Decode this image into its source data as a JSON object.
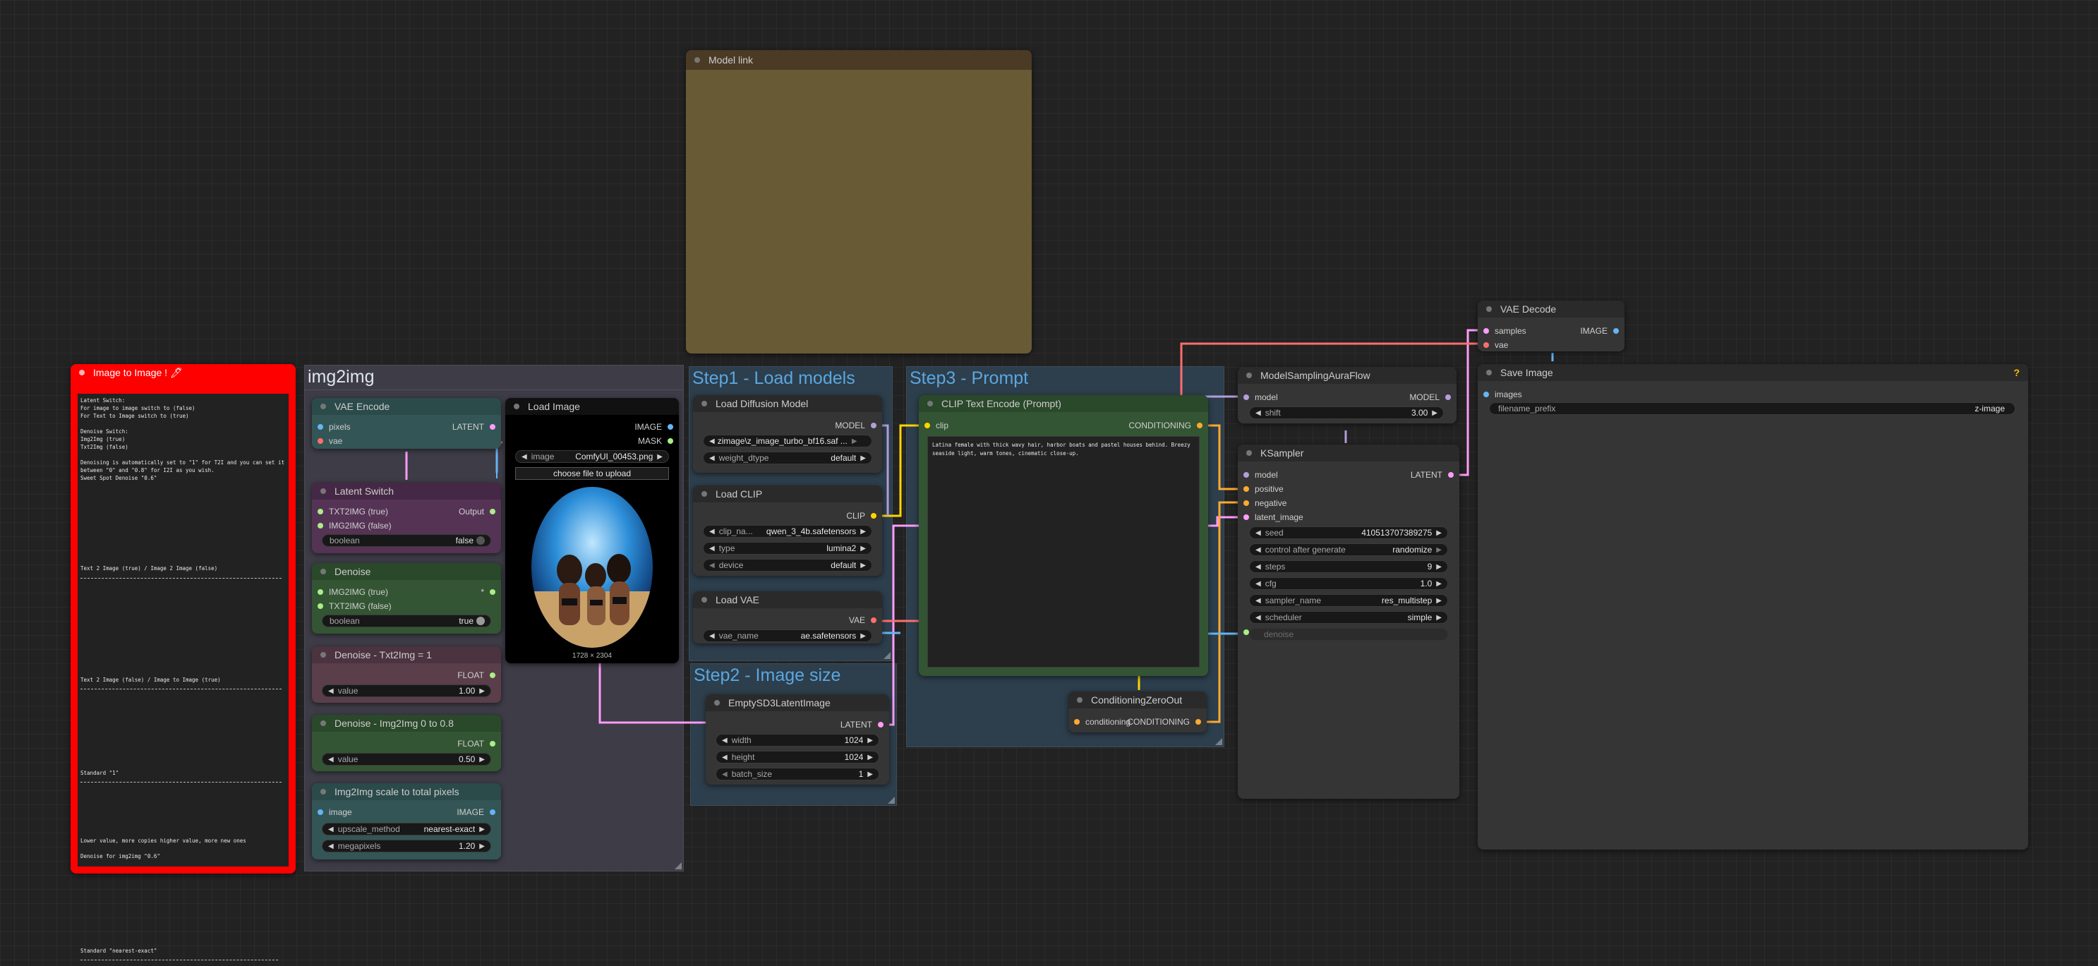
{
  "groups": {
    "img2img": "img2img",
    "step1": "Step1 - Load models",
    "step2": "Step2 - Image size",
    "step3": "Step3 - Prompt"
  },
  "notes_node": {
    "title": "Image to Image ! 🖊",
    "text": "Latent Switch:\nFor image to image switch to (false)\nFor Text to Image switch to (true)\n\nDenoise Switch:\nImg2Img (true)\nTxt2Img (false)\n\nDenoising is automatically set to \"1\" for T2I and you can set it\nbetween \"0\" and \"0.8\" for I2I as you wish.\nSweet Spot Denoise \"0.6\"",
    "line1": "Text 2 Image (true) / Image 2 Image (false)",
    "line2": "Text 2 Image (false) / Image to Image (true)",
    "line3": "Standard \"1\"",
    "line4": "Lower value, more copies higher value, more new ones",
    "line5": "Denoise for img2img \"0.6\"",
    "line6": "Standard \"nearest-exact\""
  },
  "model_link": {
    "title": "Model link"
  },
  "vae_encode": {
    "title": "VAE Encode",
    "in_pixels": "pixels",
    "in_vae": "vae",
    "out": "LATENT"
  },
  "latent_switch": {
    "title": "Latent Switch",
    "in1": "TXT2IMG (true)",
    "in2": "IMG2IMG (false)",
    "out": "Output",
    "widget_label": "boolean",
    "widget_value": "false"
  },
  "denoise": {
    "title": "Denoise",
    "in1": "IMG2IMG (true)",
    "in2": "TXT2IMG (false)",
    "out": "*",
    "widget_label": "boolean",
    "widget_value": "true"
  },
  "denoise_t2i": {
    "title": "Denoise - Txt2Img = 1",
    "out": "FLOAT",
    "widget_label": "value",
    "widget_value": "1.00"
  },
  "denoise_i2i": {
    "title": "Denoise - Img2Img 0 to 0.8",
    "out": "FLOAT",
    "widget_label": "value",
    "widget_value": "0.50"
  },
  "scale": {
    "title": "Img2Img scale to total pixels",
    "in": "image",
    "out": "IMAGE",
    "w1_label": "upscale_method",
    "w1_value": "nearest-exact",
    "w2_label": "megapixels",
    "w2_value": "1.20"
  },
  "load_image": {
    "title": "Load Image",
    "out1": "IMAGE",
    "out2": "MASK",
    "w_label": "image",
    "w_value": "ComfyUI_00453.png",
    "upload": "choose file to upload",
    "size": "1728 × 2304"
  },
  "load_diffusion": {
    "title": "Load Diffusion Model",
    "out": "MODEL",
    "w1_value": "zimage\\z_image_turbo_bf16.saf ...",
    "w2_label": "weight_dtype",
    "w2_value": "default"
  },
  "load_clip": {
    "title": "Load CLIP",
    "out": "CLIP",
    "w1_label": "clip_na...",
    "w1_value": "qwen_3_4b.safetensors",
    "w2_label": "type",
    "w2_value": "lumina2",
    "w3_label": "device",
    "w3_value": "default"
  },
  "load_vae": {
    "title": "Load VAE",
    "out": "VAE",
    "w_label": "vae_name",
    "w_value": "ae.safetensors"
  },
  "empty_latent": {
    "title": "EmptySD3LatentImage",
    "out": "LATENT",
    "w1_label": "width",
    "w1_value": "1024",
    "w2_label": "height",
    "w2_value": "1024",
    "w3_label": "batch_size",
    "w3_value": "1"
  },
  "clip_text": {
    "title": "CLIP Text Encode (Prompt)",
    "in": "clip",
    "out": "CONDITIONING",
    "prompt": "Latina female with thick wavy hair, harbor boats and pastel houses behind. Breezy seaside light, warm tones, cinematic close-up."
  },
  "cond_zero": {
    "title": "ConditioningZeroOut",
    "in": "conditioning",
    "out": "CONDITIONING"
  },
  "model_sampling": {
    "title": "ModelSamplingAuraFlow",
    "in": "model",
    "out": "MODEL",
    "w_label": "shift",
    "w_value": "3.00"
  },
  "ksampler": {
    "title": "KSampler",
    "inputs": [
      "model",
      "positive",
      "negative",
      "latent_image"
    ],
    "out": "LATENT",
    "widgets": [
      {
        "label": "seed",
        "value": "410513707389275"
      },
      {
        "label": "control after generate",
        "value": "randomize"
      },
      {
        "label": "steps",
        "value": "9"
      },
      {
        "label": "cfg",
        "value": "1.0"
      },
      {
        "label": "sampler_name",
        "value": "res_multistep"
      },
      {
        "label": "scheduler",
        "value": "simple"
      }
    ],
    "denoise": "denoise"
  },
  "vae_decode": {
    "title": "VAE Decode",
    "in1": "samples",
    "in2": "vae",
    "out": "IMAGE"
  },
  "save_image": {
    "title": "Save Image",
    "badge": "?",
    "in": "images",
    "w_label": "filename_prefix",
    "w_value": "z-image"
  },
  "colors": {
    "model": "#b39ddb",
    "clip": "#ffd500",
    "vae": "#ff6e6e",
    "latent": "#ff9cf9",
    "image": "#64b5f6",
    "conditioning": "#ffa931",
    "float": "#aaee88"
  }
}
